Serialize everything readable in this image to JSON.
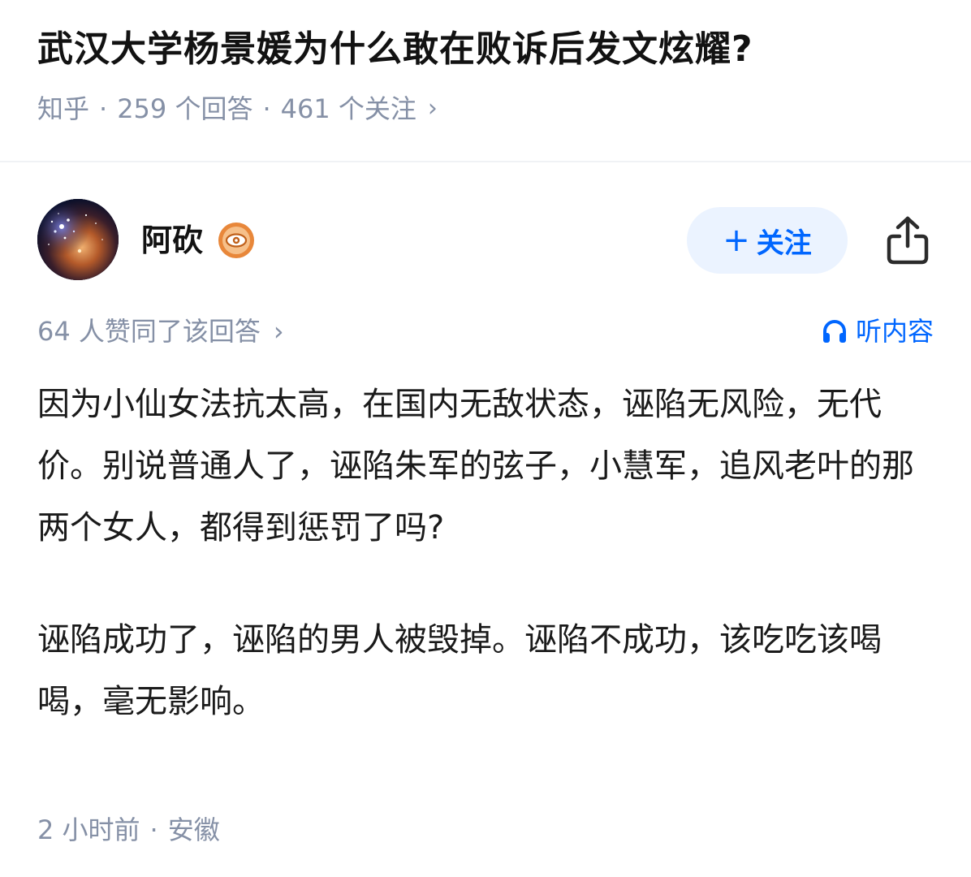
{
  "question": {
    "title": "武汉大学杨景媛为什么敢在败诉后发文炫耀?",
    "source": "知乎",
    "answers_count": "259 个回答",
    "followers_count": "461 个关注",
    "separator": "·",
    "chevron": "›"
  },
  "author": {
    "name": "阿砍",
    "avatar_icon": "galaxy-avatar",
    "badge_icon": "eye-badge-icon",
    "follow_label": "关注",
    "follow_plus": "+",
    "share_icon": "share-icon"
  },
  "upvote": {
    "text": "64 人赞同了该回答",
    "chevron": "›"
  },
  "listen": {
    "label": "听内容",
    "icon": "headphones-icon"
  },
  "content": {
    "paragraphs": [
      "因为小仙女法抗太高，在国内无敌状态，诬陷无风险，无代价。别说普通人了，诬陷朱军的弦子，小慧军，追风老叶的那两个女人，都得到惩罚了吗?",
      "诬陷成功了，诬陷的男人被毁掉。诬陷不成功，该吃吃该喝喝，毫无影响。"
    ]
  },
  "footer": {
    "time": "2 小时前",
    "separator": "·",
    "location": "安徽"
  },
  "colors": {
    "accent": "#0066ff",
    "follow_bg": "#ebf3ff",
    "meta_gray": "#8590a6",
    "text": "#1a1a1a"
  }
}
